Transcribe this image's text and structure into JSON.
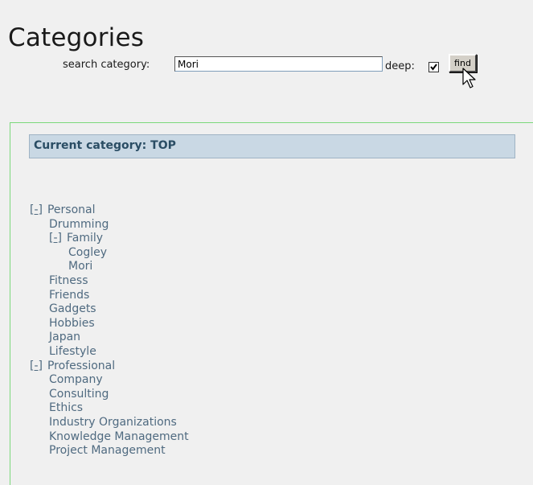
{
  "page": {
    "title": "Categories"
  },
  "search": {
    "label": "search category:",
    "value": "Mori",
    "deep_label": "deep:",
    "deep_checked": true,
    "find_label": "find"
  },
  "panel": {
    "header": "Current category: TOP",
    "tree": [
      {
        "toggle": "[-]",
        "label": "Personal",
        "children": [
          {
            "label": "Drumming"
          },
          {
            "toggle": "[-]",
            "label": "Family",
            "children": [
              {
                "label": "Cogley"
              },
              {
                "label": "Mori"
              }
            ]
          },
          {
            "label": "Fitness"
          },
          {
            "label": "Friends"
          },
          {
            "label": "Gadgets"
          },
          {
            "label": "Hobbies"
          },
          {
            "label": "Japan"
          },
          {
            "label": "Lifestyle"
          }
        ]
      },
      {
        "toggle": "[-]",
        "label": "Professional",
        "children": [
          {
            "label": "Company"
          },
          {
            "label": "Consulting"
          },
          {
            "label": "Ethics"
          },
          {
            "label": "Industry Organizations"
          },
          {
            "label": "Knowledge Management"
          },
          {
            "label": "Project Management"
          }
        ]
      }
    ]
  },
  "colors": {
    "panel_border": "#7cd97c",
    "header_bg": "#c9d8e4",
    "link": "#4f6a80"
  }
}
